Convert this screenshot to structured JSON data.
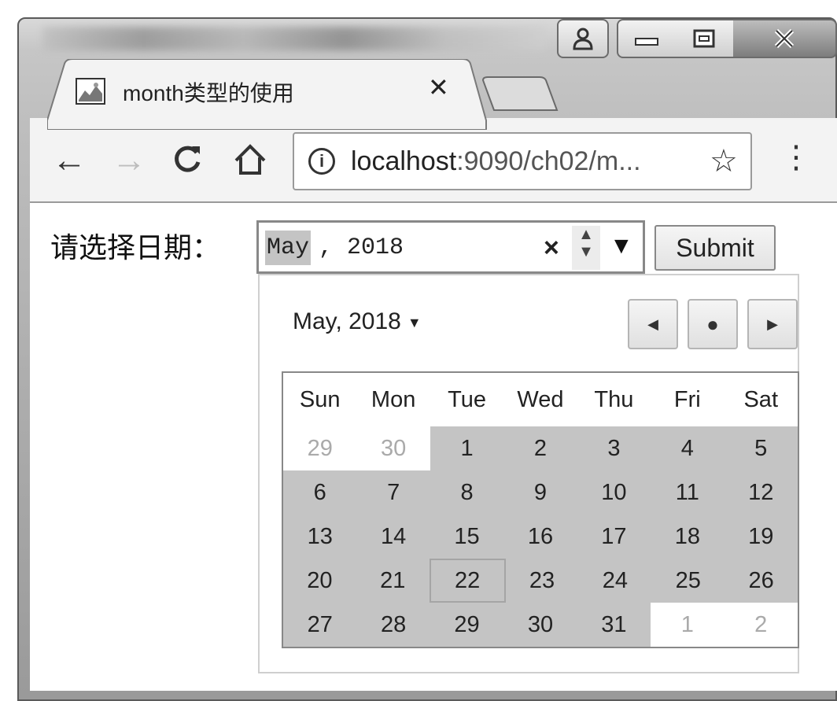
{
  "window": {
    "tab_title": "month类型的使用",
    "tab_close": "✕"
  },
  "toolbar": {
    "url_host": "localhost",
    "url_rest": ":9090/ch02/m..."
  },
  "page": {
    "label": "请选择日期：",
    "month_input": {
      "month": "May",
      "rest": ", 2018"
    },
    "submit_label": "Submit"
  },
  "picker": {
    "month_label": "May, 2018",
    "weekdays": [
      "Sun",
      "Mon",
      "Tue",
      "Wed",
      "Thu",
      "Fri",
      "Sat"
    ],
    "weeks": [
      [
        "29",
        "30",
        "1",
        "2",
        "3",
        "4",
        "5"
      ],
      [
        "6",
        "7",
        "8",
        "9",
        "10",
        "11",
        "12"
      ],
      [
        "13",
        "14",
        "15",
        "16",
        "17",
        "18",
        "19"
      ],
      [
        "20",
        "21",
        "22",
        "23",
        "24",
        "25",
        "26"
      ],
      [
        "27",
        "28",
        "29",
        "30",
        "31",
        "1",
        "2"
      ]
    ],
    "today": "22"
  }
}
